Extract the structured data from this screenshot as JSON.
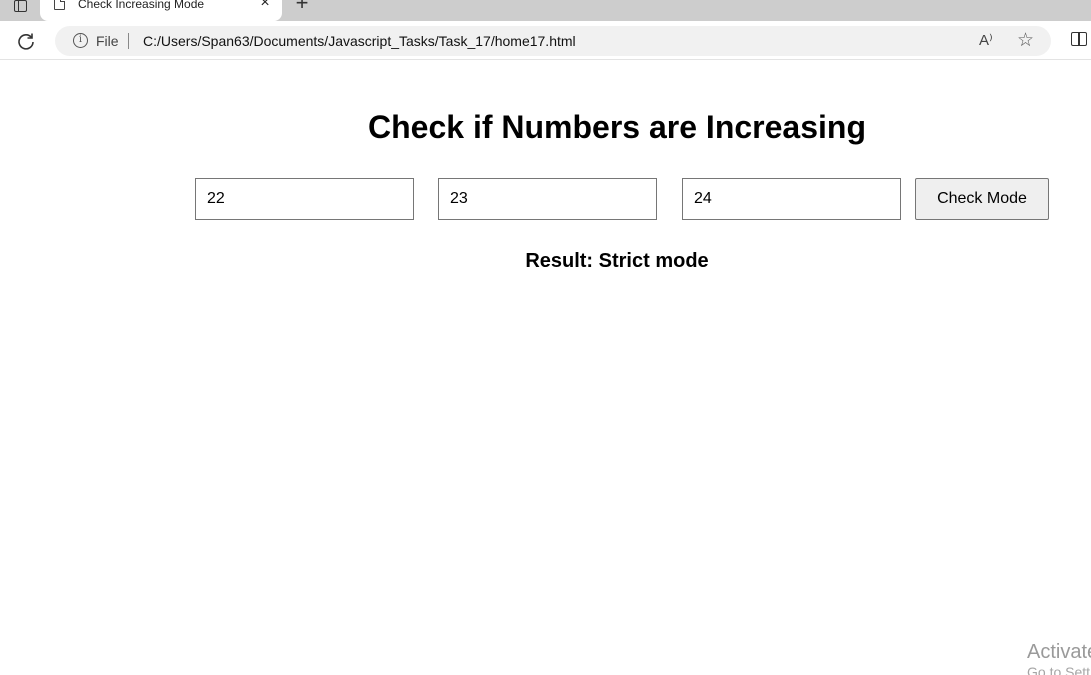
{
  "browser": {
    "tab_title": "Check Increasing Mode",
    "tab_close": "×",
    "new_tab": "+",
    "scheme_label": "File",
    "url": "C:/Users/Span63/Documents/Javascript_Tasks/Task_17/home17.html",
    "read_aloud": "A⁾",
    "info_glyph": "i",
    "favorite_glyph": "☆"
  },
  "page": {
    "title": "Check if Numbers are Increasing",
    "inputs": [
      {
        "value": "22"
      },
      {
        "value": "23"
      },
      {
        "value": "24"
      }
    ],
    "button_label": "Check Mode",
    "result": "Result: Strict mode"
  },
  "watermark": {
    "line1": "Activate",
    "line2": "Go to Sett"
  },
  "icons": {
    "sidebar": "sidebar-icon",
    "tab_page": "page-icon",
    "reload": "reload-icon",
    "info": "info-icon",
    "read_aloud": "read-aloud-icon",
    "favorite": "star-icon",
    "split_screen": "split-screen-icon"
  }
}
